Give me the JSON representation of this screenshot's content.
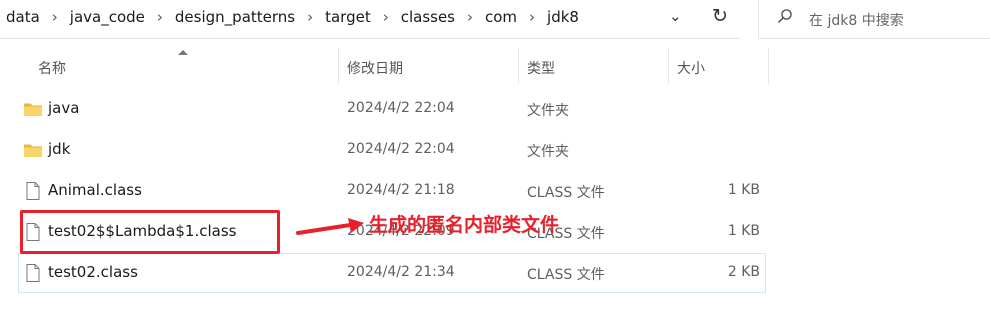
{
  "address_bar": {
    "crumbs": [
      "data",
      "java_code",
      "design_patterns",
      "target",
      "classes",
      "com",
      "jdk8"
    ],
    "dropdown_icon": "chevron-down-icon",
    "refresh_icon": "refresh-icon"
  },
  "search": {
    "placeholder": "在 jdk8 中搜索",
    "icon": "search-icon"
  },
  "columns": {
    "name": "名称",
    "modified": "修改日期",
    "type": "类型",
    "size": "大小"
  },
  "files": [
    {
      "name": "java",
      "modified": "2024/4/2 22:04",
      "type": "文件夹",
      "size": "",
      "icon": "folder-icon"
    },
    {
      "name": "jdk",
      "modified": "2024/4/2 22:04",
      "type": "文件夹",
      "size": "",
      "icon": "folder-icon"
    },
    {
      "name": "Animal.class",
      "modified": "2024/4/2 21:18",
      "type": "CLASS 文件",
      "size": "1 KB",
      "icon": "file-icon"
    },
    {
      "name": "test02$$Lambda$1.class",
      "modified": "2024/4/2 22:09",
      "type": "CLASS 文件",
      "size": "1 KB",
      "icon": "file-icon"
    },
    {
      "name": "test02.class",
      "modified": "2024/4/2 21:34",
      "type": "CLASS 文件",
      "size": "2 KB",
      "icon": "file-icon"
    }
  ],
  "annotation": {
    "text": "生成的匿名内部类文件",
    "color": "#e8202a"
  }
}
